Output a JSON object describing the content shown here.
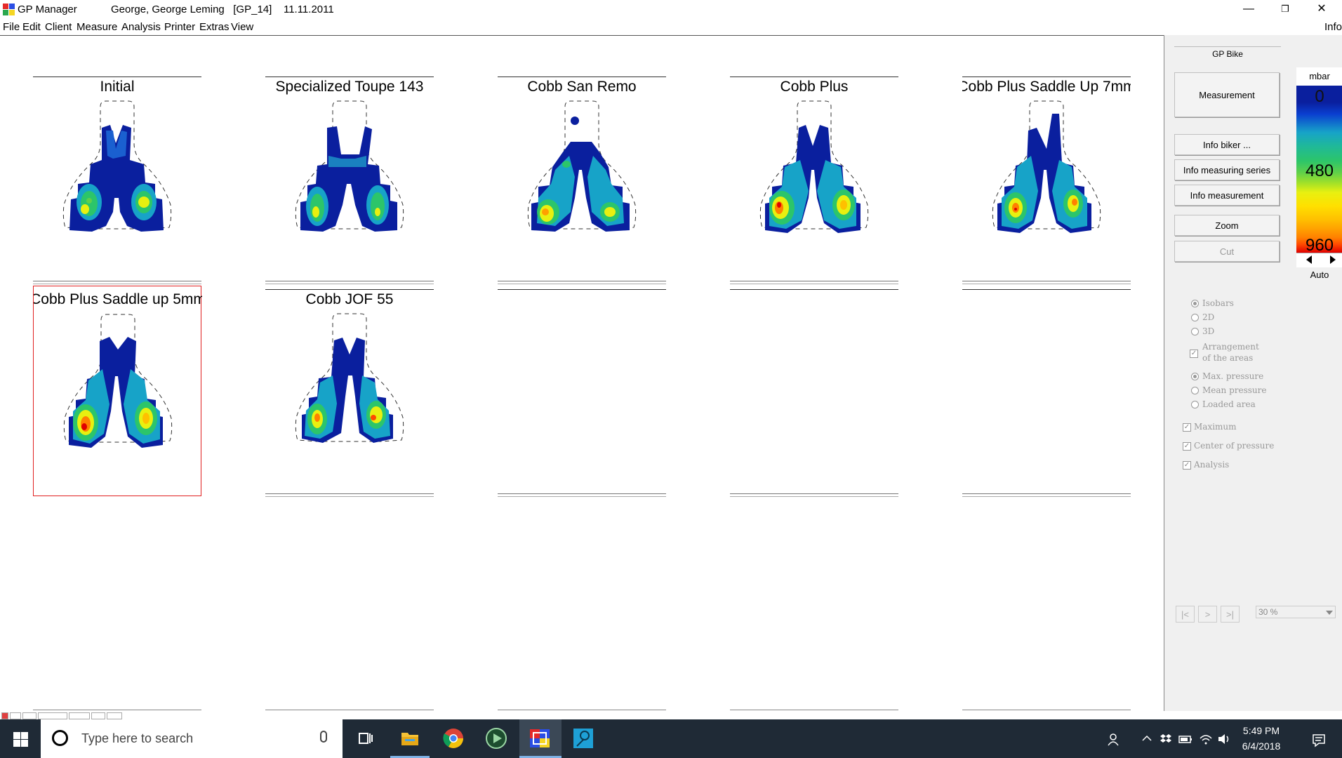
{
  "window": {
    "app_title": "GP Manager",
    "doc_title": "George, George Leming   [GP_14]    11.11.2011",
    "minimize": "—",
    "maximize": "❐",
    "close": "✕"
  },
  "menu": {
    "items": [
      "File",
      "Edit",
      "Client",
      "Measure",
      "Analysis",
      "Printer",
      "Extras",
      "View"
    ],
    "right_label": "Info"
  },
  "measurements": [
    {
      "title": "Initial"
    },
    {
      "title": "Specialized Toupe 143"
    },
    {
      "title": "Cobb San Remo"
    },
    {
      "title": "Cobb Plus"
    },
    {
      "title": "Cobb Plus Saddle Up 7mm"
    },
    {
      "title": "Cobb Plus Saddle up 5mm"
    },
    {
      "title": "Cobb JOF 55"
    }
  ],
  "panel": {
    "title": "GP Bike",
    "buttons": {
      "measurement": "Measurement",
      "info_biker": "Info biker ...",
      "info_series": "Info measuring series",
      "info_measurement": "Info measurement",
      "zoom": "Zoom",
      "cut": "Cut"
    },
    "scale": {
      "unit": "mbar",
      "min": "0",
      "mid": "480",
      "max": "960",
      "auto": "Auto"
    },
    "view_options": {
      "isobars": "Isobars",
      "two_d": "2D",
      "three_d": "3D",
      "arrangement": "Arrangement",
      "arrangement2": "of the areas"
    },
    "pressure_options": {
      "max": "Max. pressure",
      "mean": "Mean pressure",
      "loaded": "Loaded area"
    },
    "checks": {
      "maximum": "Maximum",
      "center": "Center of pressure",
      "analysis": "Analysis"
    },
    "nav": {
      "first": "|<",
      "next": ">",
      "last": ">|",
      "zoom_value": "30 %"
    }
  },
  "taskbar": {
    "search_placeholder": "Type here to search",
    "time": "5:49 PM",
    "date": "6/4/2018"
  }
}
